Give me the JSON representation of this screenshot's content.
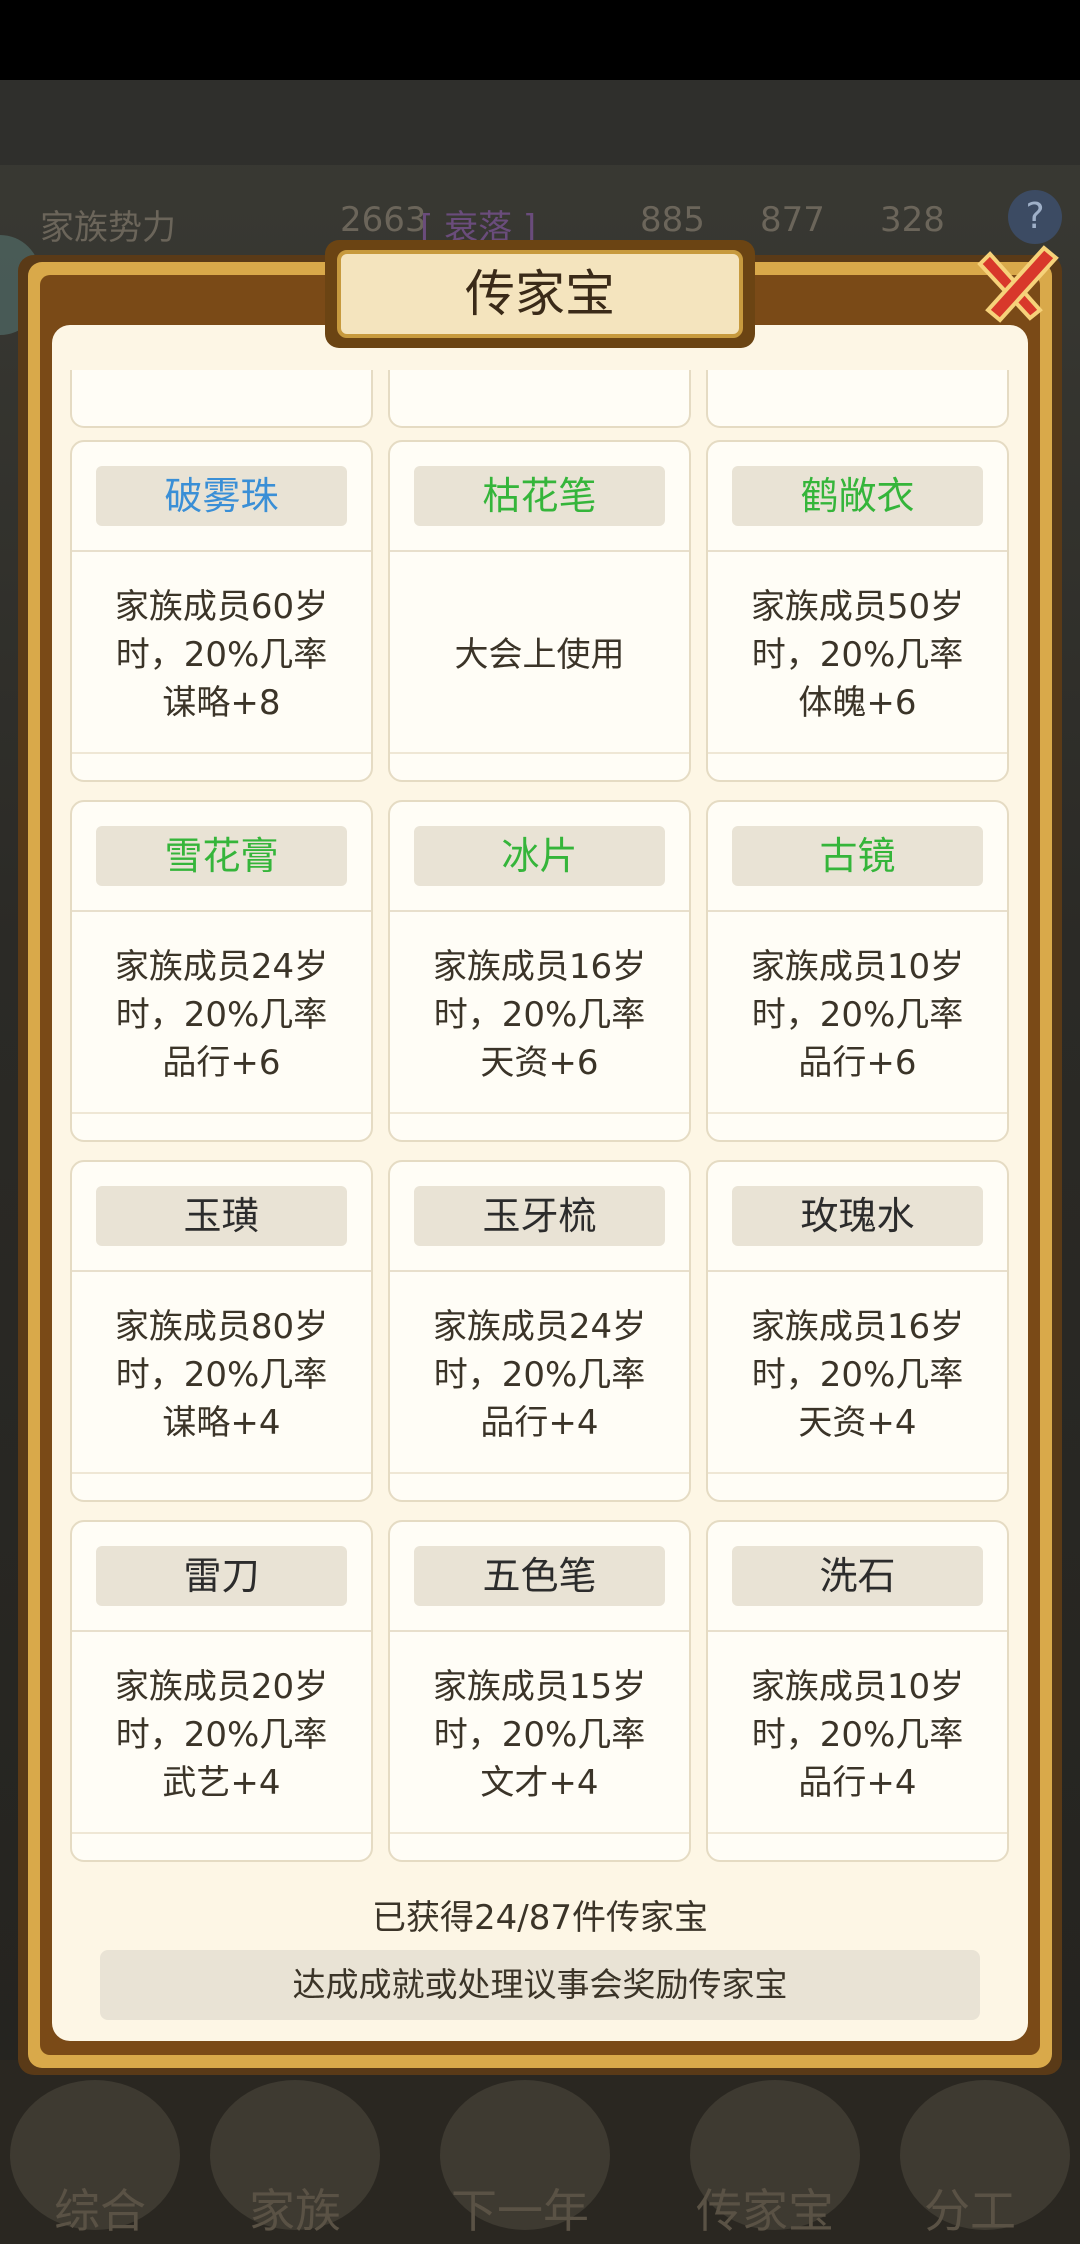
{
  "header": {
    "stat_label": "家族势力",
    "power_value": "2663",
    "power_rank": "[ 衰落 ]",
    "res1": "885",
    "res2": "877",
    "res3": "328",
    "help": "?"
  },
  "dialog": {
    "title": "传家宝",
    "items": [
      {
        "name": "破雾珠",
        "name_color": "#3a8fd6",
        "desc": "家族成员60岁\n时，20%几率\n谋略+8"
      },
      {
        "name": "枯花笔",
        "name_color": "#35b53a",
        "desc": "大会上使用"
      },
      {
        "name": "鹤敞衣",
        "name_color": "#35b53a",
        "desc": "家族成员50岁\n时，20%几率\n体魄+6"
      },
      {
        "name": "雪花膏",
        "name_color": "#35b53a",
        "desc": "家族成员24岁\n时，20%几率\n品行+6"
      },
      {
        "name": "冰片",
        "name_color": "#35b53a",
        "desc": "家族成员16岁\n时，20%几率\n天资+6"
      },
      {
        "name": "古镜",
        "name_color": "#35b53a",
        "desc": "家族成员10岁\n时，20%几率\n品行+6"
      },
      {
        "name": "玉璜",
        "name_color": "#2c2c2c",
        "desc": "家族成员80岁\n时，20%几率\n谋略+4"
      },
      {
        "name": "玉牙梳",
        "name_color": "#2c2c2c",
        "desc": "家族成员24岁\n时，20%几率\n品行+4"
      },
      {
        "name": "玫瑰水",
        "name_color": "#2c2c2c",
        "desc": "家族成员16岁\n时，20%几率\n天资+4"
      },
      {
        "name": "雷刀",
        "name_color": "#2c2c2c",
        "desc": "家族成员20岁\n时，20%几率\n武艺+4"
      },
      {
        "name": "五色笔",
        "name_color": "#2c2c2c",
        "desc": "家族成员15岁\n时，20%几率\n文才+4"
      },
      {
        "name": "洗石",
        "name_color": "#2c2c2c",
        "desc": "家族成员10岁\n时，20%几率\n品行+4"
      }
    ],
    "count_text": "已获得24/87件传家宝",
    "hint_text": "达成成就或处理议事会奖励传家宝"
  },
  "bottom_nav": [
    "综合",
    "家族",
    "下一年",
    "传家宝",
    "分工"
  ]
}
